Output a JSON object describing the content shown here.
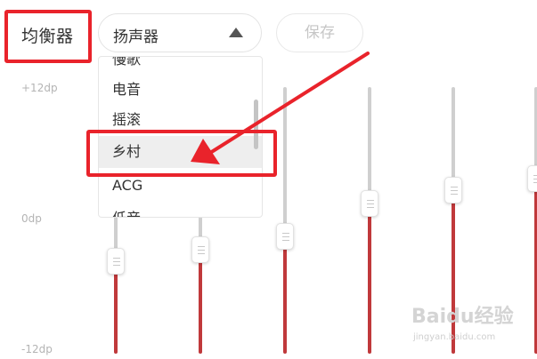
{
  "header": {
    "title": "均衡器",
    "device_select": {
      "value": "扬声器",
      "caret_icon": "triangle-up-icon"
    },
    "save_button": "保存"
  },
  "axis": {
    "max_label": "+12dp",
    "mid_label": "0dp",
    "min_label": "-12dp"
  },
  "dropdown": {
    "items": [
      {
        "label": "慢歌",
        "selected": false
      },
      {
        "label": "电音",
        "selected": false
      },
      {
        "label": "摇滚",
        "selected": false
      },
      {
        "label": "乡村",
        "selected": true
      },
      {
        "label": "ACG",
        "selected": false
      },
      {
        "label": "低音",
        "selected": false
      }
    ]
  },
  "equalizer": {
    "range_db": [
      -12,
      12
    ],
    "bands": [
      {
        "gain_db": -3.7
      },
      {
        "gain_db": -2.6
      },
      {
        "gain_db": -1.4
      },
      {
        "gain_db": 1.5
      },
      {
        "gain_db": 2.7
      },
      {
        "gain_db": 3.8
      }
    ]
  },
  "colors": {
    "annotation": "#e9232b",
    "track_active": "#c0393b",
    "track_inactive": "#cfcfcf"
  },
  "watermark": {
    "brand": "Baidu经验",
    "url": "jingyan.baidu.com"
  }
}
